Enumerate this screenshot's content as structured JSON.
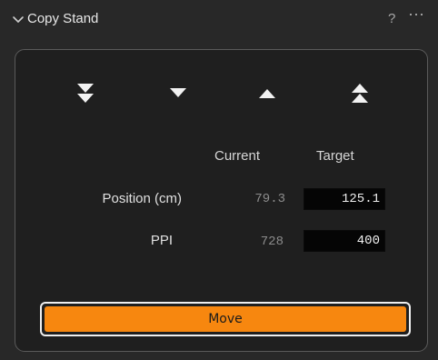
{
  "panel": {
    "title": "Copy Stand",
    "help_label": "?",
    "more_label": "⋯"
  },
  "nav": {
    "buttons": [
      {
        "name": "move-down-fast-icon"
      },
      {
        "name": "move-down-icon"
      },
      {
        "name": "move-up-icon"
      },
      {
        "name": "move-up-fast-icon"
      }
    ],
    "icon_color": "#f2f2f2"
  },
  "table": {
    "col_current": "Current",
    "col_target": "Target",
    "rows": [
      {
        "label": "Position (cm)",
        "current": "79.3",
        "target": "125.1"
      },
      {
        "label": "PPI",
        "current": "728",
        "target": "400"
      }
    ]
  },
  "move": {
    "label": "Move",
    "color": "#f7870f"
  }
}
